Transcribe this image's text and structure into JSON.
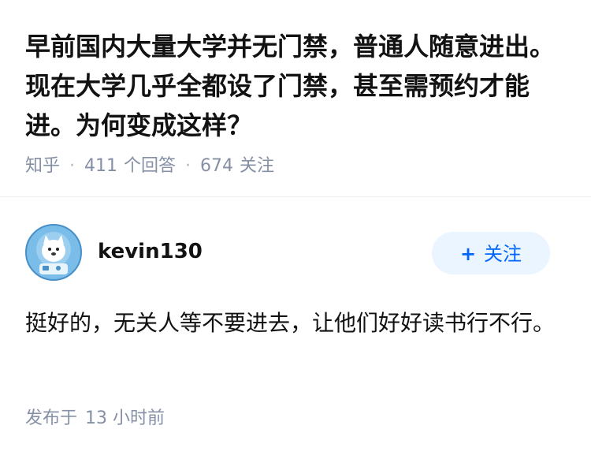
{
  "question": {
    "title": "早前国内大量大学并无门禁，普通人随意进出。现在大学几乎全都设了门禁，甚至需预约才能进。为何变成这样？",
    "source": "知乎",
    "answer_count": "411",
    "answer_count_label": "个回答",
    "follower_count": "674",
    "follower_count_label": "关注"
  },
  "answer": {
    "author": {
      "name": "kevin130",
      "avatar_icon": "husky-astronaut-avatar"
    },
    "follow_button": {
      "icon": "plus-icon",
      "plus": "+",
      "label": "关注"
    },
    "content": "挺好的，无关人等不要进去，让他们好好读书行不行。",
    "published_label": "发布于",
    "published_time": "13 小时前"
  },
  "colors": {
    "title": "#121212",
    "meta": "#8590a6",
    "follow_bg": "#ebf5ff",
    "follow_text": "#0066ff",
    "avatar_bg": "#6cb2e2"
  }
}
